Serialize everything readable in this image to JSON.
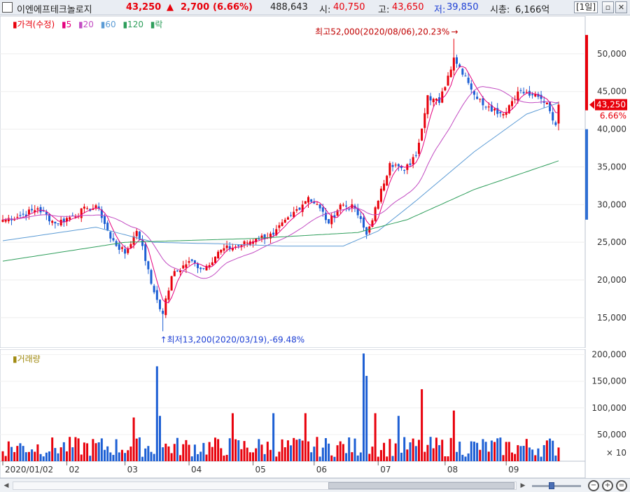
{
  "header": {
    "name": "이엔에프테크놀로지",
    "price": "43,250",
    "change_arrow": "▲",
    "change": "2,700",
    "change_pct": "(6.66%)",
    "volume": "488,643",
    "open_label": "시:",
    "open": "40,750",
    "high_label": "고:",
    "high": "43,650",
    "low_label": "저:",
    "low": "39,850",
    "mcap_label": "시총:",
    "mcap": "6,166억",
    "period": "[1일]",
    "btn_restore": "▫",
    "btn_close": "✕"
  },
  "legend": {
    "price": "▮가격(수정)",
    "ma5": "▮5",
    "ma20": "▮20",
    "ma60": "▮60",
    "ma120": "▮120",
    "other": "▮락"
  },
  "volume_legend": "▮거래량",
  "colors": {
    "up": "#e8000b",
    "down": "#1d5fd4",
    "ma5": "#e5007e",
    "ma20": "#c24bc2",
    "ma60": "#5b9bd5",
    "ma120": "#2e9e5b"
  },
  "chart_data": [
    {
      "type": "candlestick",
      "ylim": [
        11000,
        55000
      ],
      "y_ticks": [
        "50,000",
        "45,000",
        "40,000",
        "35,000",
        "30,000",
        "25,000",
        "20,000",
        "15,000"
      ],
      "y_tick_values": [
        50000,
        45000,
        40000,
        35000,
        30000,
        25000,
        20000,
        15000
      ],
      "current_price_label": "43,250",
      "current_change_label": "6.66%",
      "annotation_high": "최고52,000(2020/08/06),20.23%",
      "annotation_low": "최저13,200(2020/03/19),-69.48%",
      "anchors": [
        [
          "2020/01/02",
          28000
        ],
        [
          "2020/01/10",
          28500
        ],
        [
          "2020/01/20",
          29500
        ],
        [
          "2020/01/28",
          27500
        ],
        [
          "2020/02/05",
          28500
        ],
        [
          "2020/02/12",
          29500
        ],
        [
          "2020/02/18",
          29500
        ],
        [
          "2020/02/24",
          25500
        ],
        [
          "2020/03/02",
          23500
        ],
        [
          "2020/03/06",
          26500
        ],
        [
          "2020/03/10",
          24500
        ],
        [
          "2020/03/13",
          19500
        ],
        [
          "2020/03/19",
          15500
        ],
        [
          "2020/03/24",
          20500
        ],
        [
          "2020/04/01",
          22500
        ],
        [
          "2020/04/08",
          21500
        ],
        [
          "2020/04/16",
          24000
        ],
        [
          "2020/04/24",
          24500
        ],
        [
          "2020/05/04",
          25500
        ],
        [
          "2020/05/12",
          26000
        ],
        [
          "2020/05/20",
          28500
        ],
        [
          "2020/05/28",
          31000
        ],
        [
          "2020/06/03",
          29500
        ],
        [
          "2020/06/08",
          27500
        ],
        [
          "2020/06/12",
          30000
        ],
        [
          "2020/06/19",
          29500
        ],
        [
          "2020/06/25",
          26000
        ],
        [
          "2020/07/01",
          30500
        ],
        [
          "2020/07/07",
          35500
        ],
        [
          "2020/07/14",
          34500
        ],
        [
          "2020/07/20",
          36500
        ],
        [
          "2020/07/24",
          44500
        ],
        [
          "2020/07/30",
          43500
        ],
        [
          "2020/08/06",
          49500
        ],
        [
          "2020/08/12",
          47000
        ],
        [
          "2020/08/18",
          44000
        ],
        [
          "2020/08/24",
          43000
        ],
        [
          "2020/08/31",
          42000
        ],
        [
          "2020/09/07",
          45000
        ],
        [
          "2020/09/14",
          44500
        ],
        [
          "2020/09/21",
          43500
        ],
        [
          "2020/09/24",
          40550
        ],
        [
          "2020/09/25",
          43250
        ]
      ],
      "ma60_points": [
        [
          "2020/01/02",
          25200
        ],
        [
          "2020/02/15",
          27000
        ],
        [
          "2020/03/15",
          25000
        ],
        [
          "2020/04/15",
          24800
        ],
        [
          "2020/05/15",
          24500
        ],
        [
          "2020/06/15",
          24500
        ],
        [
          "2020/07/01",
          26500
        ],
        [
          "2020/07/20",
          30500
        ],
        [
          "2020/08/15",
          37000
        ],
        [
          "2020/09/10",
          42000
        ],
        [
          "2020/09/25",
          43500
        ]
      ],
      "ma120_points": [
        [
          "2020/01/02",
          22500
        ],
        [
          "2020/03/01",
          25000
        ],
        [
          "2020/05/01",
          25500
        ],
        [
          "2020/06/20",
          26300
        ],
        [
          "2020/07/15",
          28000
        ],
        [
          "2020/08/15",
          32000
        ],
        [
          "2020/09/25",
          35800
        ]
      ]
    },
    {
      "type": "bar",
      "ylim": [
        0,
        210000
      ],
      "y_ticks": [
        "200,000",
        "150,000",
        "100,000",
        "50,000"
      ],
      "y_tick_values": [
        200000,
        150000,
        100000,
        50000
      ],
      "unit_label": "× 10",
      "spikes": [
        [
          "2020/03/17",
          178000
        ],
        [
          "2020/03/18",
          85000
        ],
        [
          "2020/03/05",
          82000
        ],
        [
          "2020/06/24",
          202000
        ],
        [
          "2020/06/25",
          160000
        ],
        [
          "2020/06/30",
          90000
        ],
        [
          "2020/07/22",
          135000
        ],
        [
          "2020/07/10",
          85000
        ],
        [
          "2020/05/27",
          90000
        ],
        [
          "2020/05/12",
          90000
        ],
        [
          "2020/04/22",
          90000
        ],
        [
          "2020/08/06",
          95000
        ]
      ]
    }
  ],
  "x_axis": {
    "labels": [
      "2020/01/02",
      "02",
      "03",
      "04",
      "05",
      "06",
      "07",
      "08",
      "09"
    ],
    "dates": [
      "2020/01/02",
      "2020/02/01",
      "2020/03/01",
      "2020/04/01",
      "2020/05/01",
      "2020/06/01",
      "2020/07/01",
      "2020/08/01",
      "2020/09/01"
    ]
  }
}
